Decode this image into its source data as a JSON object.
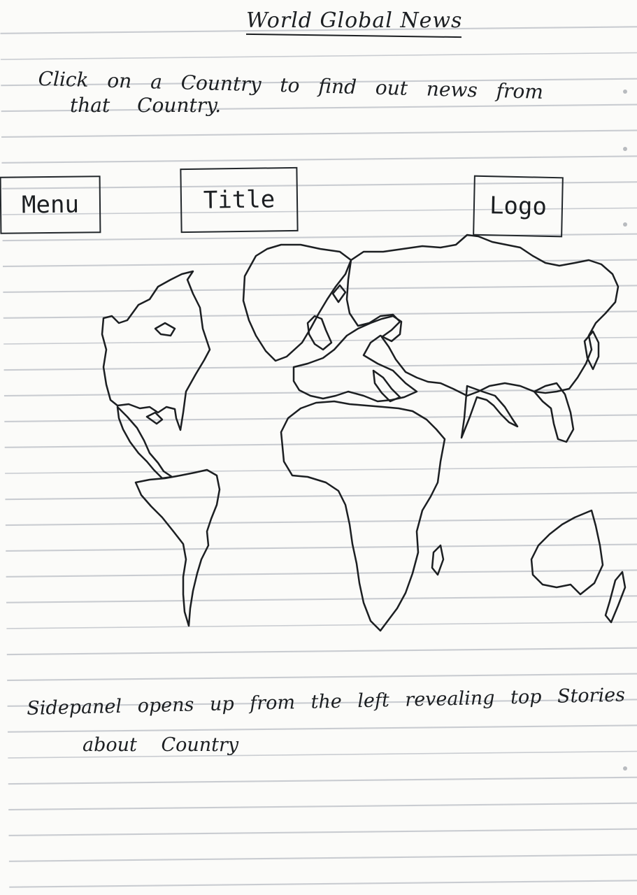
{
  "header": {
    "title": "World Global News"
  },
  "instructions": {
    "line1": "Click on a Country to find out news from",
    "line2": "that Country."
  },
  "nav": {
    "menu_label": "Menu",
    "title_label": "Title",
    "logo_label": "Logo"
  },
  "note": {
    "line1": "Sidepanel opens up from the left revealing top Stories",
    "line2": "about Country"
  }
}
